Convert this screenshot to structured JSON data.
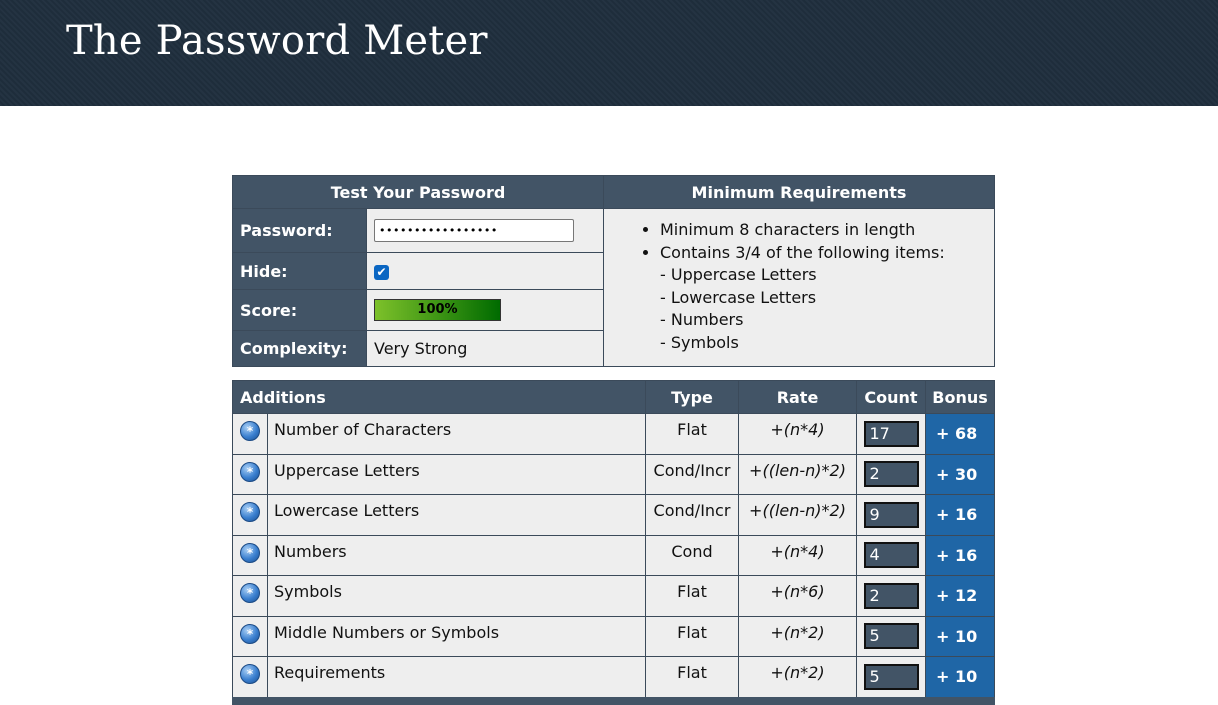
{
  "header": {
    "title": "The Password Meter"
  },
  "test": {
    "title": "Test Your Password",
    "password_label": "Password:",
    "password_value": "•••••••••••••••••",
    "hide_label": "Hide:",
    "hide_checked": "✔",
    "score_label": "Score:",
    "score_value": "100%",
    "score_fraction": 1.0,
    "complexity_label": "Complexity:",
    "complexity_value": "Very Strong"
  },
  "requirements": {
    "title": "Minimum Requirements",
    "items": [
      "Minimum 8 characters in length",
      "Contains 3/4 of the following items:"
    ],
    "subitems": [
      "- Uppercase Letters",
      "- Lowercase Letters",
      "- Numbers",
      "- Symbols"
    ]
  },
  "additions": {
    "headers": {
      "name": "Additions",
      "type": "Type",
      "rate": "Rate",
      "count": "Count",
      "bonus": "Bonus"
    },
    "rows": [
      {
        "name": "Number of Characters",
        "type": "Flat",
        "rate": "+(n*4)",
        "count": "17",
        "bonus": "+ 68"
      },
      {
        "name": "Uppercase Letters",
        "type": "Cond/Incr",
        "rate": "+((len-n)*2)",
        "count": "2",
        "bonus": "+ 30"
      },
      {
        "name": "Lowercase Letters",
        "type": "Cond/Incr",
        "rate": "+((len-n)*2)",
        "count": "9",
        "bonus": "+ 16"
      },
      {
        "name": "Numbers",
        "type": "Cond",
        "rate": "+(n*4)",
        "count": "4",
        "bonus": "+ 16"
      },
      {
        "name": "Symbols",
        "type": "Flat",
        "rate": "+(n*6)",
        "count": "2",
        "bonus": "+ 12"
      },
      {
        "name": "Middle Numbers or Symbols",
        "type": "Flat",
        "rate": "+(n*2)",
        "count": "5",
        "bonus": "+ 10"
      },
      {
        "name": "Requirements",
        "type": "Flat",
        "rate": "+(n*2)",
        "count": "5",
        "bonus": "+ 10"
      }
    ],
    "info_icon": "info-icon"
  },
  "colors": {
    "header_bg": "#1f2e3d",
    "table_header": "#425466",
    "bonus_bg": "#1f66a6",
    "cell_bg": "#eeeeee"
  }
}
